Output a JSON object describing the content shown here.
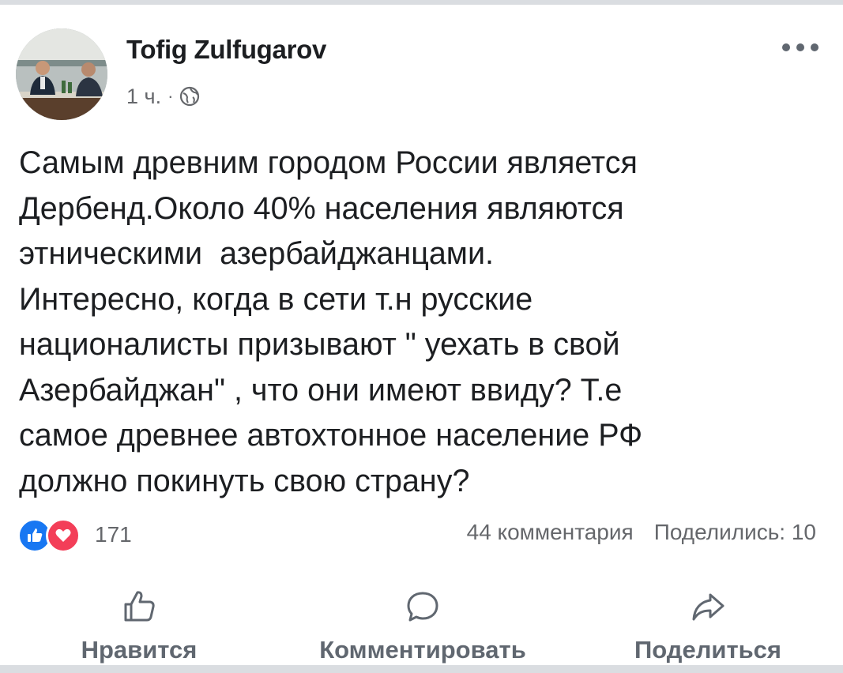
{
  "post": {
    "author": "Tofig Zulfugarov",
    "time": "1 ч.",
    "separator": "·",
    "privacy_icon": "globe-icon",
    "text": "Самым древним городом России является\nДербенд.Около 40% населения являются\nэтническими  азербайджанцами.\nИнтересно, когда в сети т.н русские\nнационалисты призывают \" уехать в свой\nАзербайджан\" , что они имеют ввиду? Т.е\nсамое древнее автохтонное население РФ\nдолжно покинуть свою страну?"
  },
  "stats": {
    "reactions_count": "171",
    "comments": "44 комментария",
    "shares": "Поделились: 10"
  },
  "actions": {
    "like": "Нравится",
    "comment": "Комментировать",
    "share": "Поделиться"
  },
  "colors": {
    "like_blue": "#1877f2",
    "love_red": "#f33e58",
    "secondary_text": "#65676b"
  }
}
